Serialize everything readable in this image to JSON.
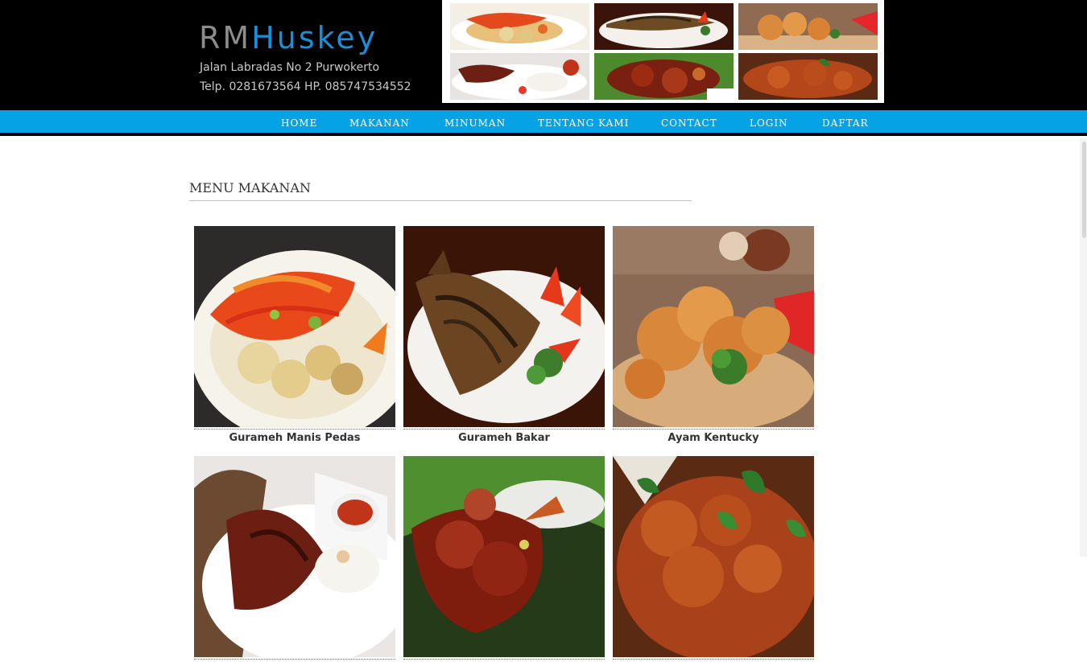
{
  "brand": {
    "part1": "RM",
    "part2": "Huskey"
  },
  "address": "Jalan Labradas No 2 Purwokerto",
  "phone": "Telp. 0281673564 HP. 085747534552",
  "nav": [
    {
      "label": "HOME"
    },
    {
      "label": "MAKANAN"
    },
    {
      "label": "MINUMAN"
    },
    {
      "label": "TENTANG KAMI"
    },
    {
      "label": "CONTACT"
    },
    {
      "label": "LOGIN"
    },
    {
      "label": "DAFTAR"
    }
  ],
  "section_title": "MENU MAKANAN",
  "menu": [
    {
      "name": "Gurameh Manis Pedas"
    },
    {
      "name": "Gurameh Bakar"
    },
    {
      "name": "Ayam Kentucky"
    },
    {
      "name": ""
    },
    {
      "name": ""
    },
    {
      "name": ""
    }
  ],
  "colors": {
    "header_bg": "#000000",
    "nav_bg": "#05a3e6",
    "brand_accent": "#1a8fd9"
  }
}
